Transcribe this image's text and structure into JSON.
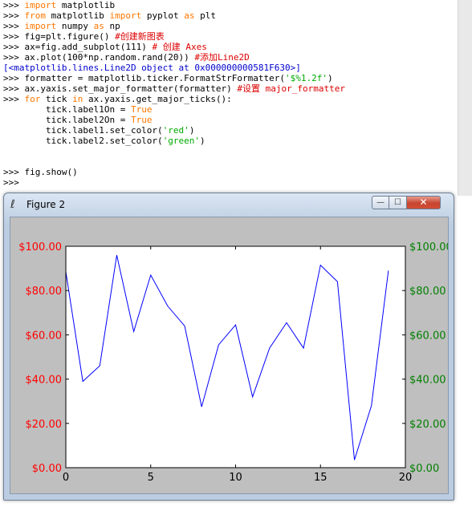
{
  "shell": {
    "lines": [
      {
        "prompt": ">>> ",
        "parts": [
          {
            "t": "import",
            "c": "kw"
          },
          {
            "t": " matplotlib",
            "c": ""
          }
        ]
      },
      {
        "prompt": ">>> ",
        "parts": [
          {
            "t": "from",
            "c": "kw"
          },
          {
            "t": " matplotlib ",
            "c": ""
          },
          {
            "t": "import",
            "c": "kw"
          },
          {
            "t": " pyplot ",
            "c": ""
          },
          {
            "t": "as",
            "c": "kw"
          },
          {
            "t": " plt",
            "c": ""
          }
        ]
      },
      {
        "prompt": ">>> ",
        "parts": [
          {
            "t": "import",
            "c": "kw"
          },
          {
            "t": " numpy ",
            "c": ""
          },
          {
            "t": "as",
            "c": "kw"
          },
          {
            "t": " np",
            "c": ""
          }
        ]
      },
      {
        "prompt": ">>> ",
        "parts": [
          {
            "t": "fig=plt.figure() ",
            "c": ""
          },
          {
            "t": "#创建新图表",
            "c": "cm"
          }
        ]
      },
      {
        "prompt": ">>> ",
        "parts": [
          {
            "t": "ax=fig.add_subplot(111) ",
            "c": ""
          },
          {
            "t": "# 创建 Axes",
            "c": "cm"
          }
        ]
      },
      {
        "prompt": ">>> ",
        "parts": [
          {
            "t": "ax.plot(100*np.random.rand(20)) ",
            "c": ""
          },
          {
            "t": "#添加Line2D",
            "c": "cm"
          }
        ]
      },
      {
        "prompt": "",
        "parts": [
          {
            "t": "[<matplotlib.lines.Line2D object at 0x000000000581F630>]",
            "c": "out"
          }
        ]
      },
      {
        "prompt": ">>> ",
        "parts": [
          {
            "t": "formatter = matplotlib.ticker.FormatStrFormatter(",
            "c": ""
          },
          {
            "t": "'$%1.2f'",
            "c": "st"
          },
          {
            "t": ")",
            "c": ""
          }
        ]
      },
      {
        "prompt": ">>> ",
        "parts": [
          {
            "t": "ax.yaxis.set_major_formatter(formatter) ",
            "c": ""
          },
          {
            "t": "#设置 major_formatter",
            "c": "cm"
          }
        ]
      },
      {
        "prompt": ">>> ",
        "parts": [
          {
            "t": "for",
            "c": "kw"
          },
          {
            "t": " tick ",
            "c": ""
          },
          {
            "t": "in",
            "c": "kw"
          },
          {
            "t": " ax.yaxis.get_major_ticks():",
            "c": ""
          }
        ]
      },
      {
        "prompt": "",
        "parts": [
          {
            "t": "        tick.label1On = ",
            "c": ""
          },
          {
            "t": "True",
            "c": "kw"
          }
        ]
      },
      {
        "prompt": "",
        "parts": [
          {
            "t": "        tick.label2On = ",
            "c": ""
          },
          {
            "t": "True",
            "c": "kw"
          }
        ]
      },
      {
        "prompt": "",
        "parts": [
          {
            "t": "        tick.label1.set_color(",
            "c": ""
          },
          {
            "t": "'red'",
            "c": "st"
          },
          {
            "t": ")",
            "c": ""
          }
        ]
      },
      {
        "prompt": "",
        "parts": [
          {
            "t": "        tick.label2.set_color(",
            "c": ""
          },
          {
            "t": "'green'",
            "c": "st"
          },
          {
            "t": ")",
            "c": ""
          }
        ]
      },
      {
        "prompt": "",
        "parts": [
          {
            "t": "",
            "c": ""
          }
        ]
      },
      {
        "prompt": "",
        "parts": [
          {
            "t": "",
            "c": ""
          }
        ]
      },
      {
        "prompt": ">>> ",
        "parts": [
          {
            "t": "fig.show()",
            "c": ""
          }
        ]
      },
      {
        "prompt": ">>> ",
        "parts": [
          {
            "t": "",
            "c": ""
          }
        ]
      }
    ]
  },
  "figure_window": {
    "title": "Figure 2",
    "feather_icon": "tk-feather-icon",
    "minimize_label": "—",
    "maximize_label": "☐",
    "close_label": "✕"
  },
  "colors": {
    "line": "#0000ff",
    "left_ticks": "#ff0000",
    "right_ticks": "#008000",
    "axes_bg": "#ffffff",
    "figure_bg": "#bfbfbf"
  },
  "chart_data": {
    "type": "line",
    "x": [
      0,
      1,
      2,
      3,
      4,
      5,
      6,
      7,
      8,
      9,
      10,
      11,
      12,
      13,
      14,
      15,
      16,
      17,
      18,
      19
    ],
    "values": [
      88.5,
      39,
      46,
      96,
      61.5,
      87,
      73,
      64,
      27.5,
      55.5,
      64.5,
      32,
      54,
      65.5,
      54,
      91.5,
      84,
      3.5,
      28,
      89
    ],
    "xlim": [
      0,
      20
    ],
    "ylim": [
      0,
      100
    ],
    "xticks": [
      0,
      5,
      10,
      15,
      20
    ],
    "xtick_labels": [
      "0",
      "5",
      "10",
      "15",
      "20"
    ],
    "yticks": [
      0,
      20,
      40,
      60,
      80,
      100
    ],
    "ytick_labels_left": [
      "$0.00",
      "$20.00",
      "$40.00",
      "$60.00",
      "$80.00",
      "$100.00"
    ],
    "ytick_labels_right": [
      "$0.00",
      "$20.00",
      "$40.00",
      "$60.00",
      "$80.00",
      "$100.00"
    ],
    "grid": false,
    "title": "",
    "xlabel": "",
    "ylabel": ""
  }
}
